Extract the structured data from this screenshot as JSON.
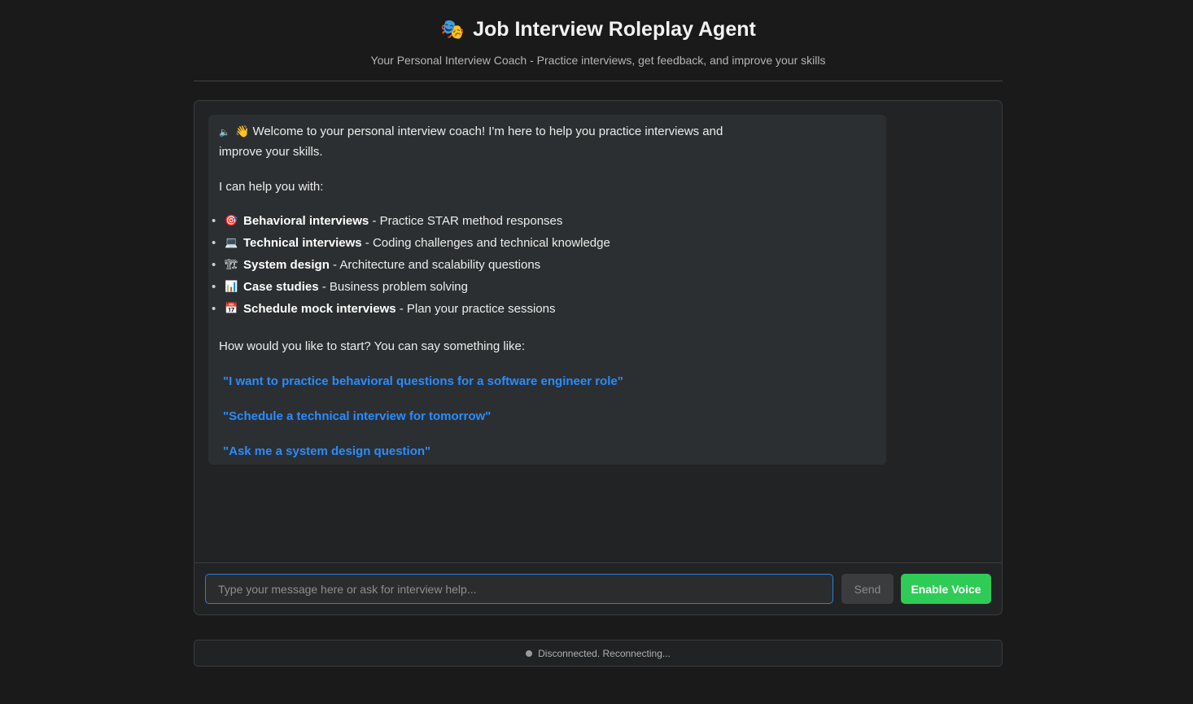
{
  "header": {
    "title_icon": "theater-masks-icon",
    "title": "Job Interview Roleplay Agent",
    "subtitle": "Your Personal Interview Coach - Practice interviews, get feedback, and improve your skills"
  },
  "message": {
    "speaker_icon": "speaker-icon",
    "wave_icon": "waving-hand-icon",
    "intro": "Welcome to your personal interview coach! I'm here to help you practice interviews and improve your skills.",
    "help_heading": "I can help you with:",
    "features": [
      {
        "icon": "target-icon",
        "glyph": "🎯",
        "name": "Behavioral interviews",
        "desc": " - Practice STAR method responses"
      },
      {
        "icon": "laptop-icon",
        "glyph": "💻",
        "name": "Technical interviews",
        "desc": " - Coding challenges and technical knowledge"
      },
      {
        "icon": "building-construction-icon",
        "glyph": "🏗",
        "name": "System design",
        "desc": " - Architecture and scalability questions"
      },
      {
        "icon": "bar-chart-icon",
        "glyph": "📊",
        "name": "Case studies",
        "desc": " - Business problem solving"
      },
      {
        "icon": "calendar-icon",
        "glyph": "📅",
        "name": "Schedule mock interviews",
        "desc": " - Plan your practice sessions"
      }
    ],
    "prompt": "How would you like to start? You can say something like:",
    "examples": [
      "\"I want to practice behavioral questions for a software engineer role\"",
      "\"Schedule a technical interview for tomorrow\"",
      "\"Ask me a system design question\""
    ]
  },
  "input": {
    "placeholder": "Type your message here or ask for interview help...",
    "value": "",
    "send_label": "Send",
    "voice_label": "Enable Voice"
  },
  "status": {
    "text": "Disconnected. Reconnecting...",
    "dot_color": "#9a9a9a"
  },
  "colors": {
    "accent_blue": "#2a8cff",
    "voice_green": "#2ecc57",
    "background": "#1a1a1a"
  }
}
